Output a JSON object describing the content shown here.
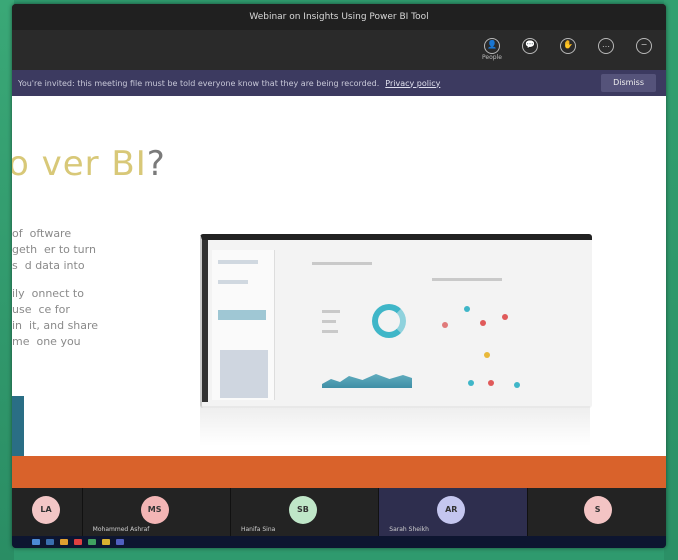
{
  "window": {
    "title": "Webinar on Insights Using Power BI Tool"
  },
  "toolbar": {
    "buttons": [
      {
        "label": "People",
        "glyph": "👤"
      },
      {
        "label": "",
        "glyph": "💬"
      },
      {
        "label": "",
        "glyph": "✋"
      },
      {
        "label": "",
        "glyph": "…"
      },
      {
        "label": "",
        "glyph": "−"
      }
    ]
  },
  "banner": {
    "text": "You're invited: this meeting file must be told everyone know that they are being recorded.",
    "link": "Privacy policy",
    "dismiss": "Dismiss"
  },
  "slide": {
    "title_main": "o ver BI",
    "title_q": "?",
    "bullets": [
      "of  oftware\ngeth  er to turn\ns  d data into",
      "ily  onnect to\nuse  ce for\nin  it, and share\nme  one you"
    ]
  },
  "participants": [
    {
      "initials": "LA",
      "name": "",
      "color": "#f3c6c6"
    },
    {
      "initials": "MS",
      "name": "Mohammed Ashraf",
      "color": "#f3b5b5"
    },
    {
      "initials": "SB",
      "name": "Hanifa Sina",
      "color": "#bfe6c8"
    },
    {
      "initials": "AR",
      "name": "Sarah Sheikh",
      "color": "#c4c6ef"
    },
    {
      "initials": "S",
      "name": "",
      "color": "#f3c4c4"
    }
  ],
  "colors": {
    "accent": "#d9622b",
    "banner": "#3c3a60",
    "background": "#2f9a6e"
  }
}
